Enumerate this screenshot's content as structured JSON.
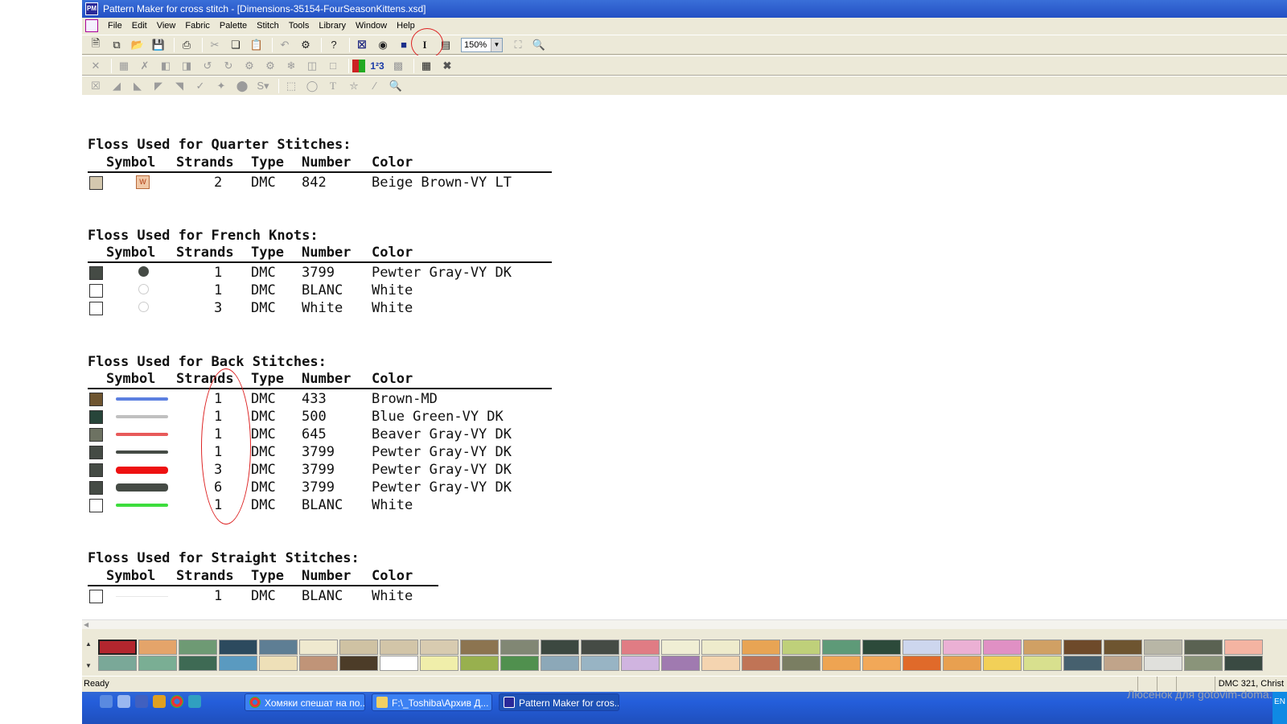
{
  "window": {
    "title": "Pattern Maker for cross stitch - [Dimensions-35154-FourSeasonKittens.xsd]",
    "app_icon_text": "PM"
  },
  "menu": [
    "File",
    "Edit",
    "View",
    "Fabric",
    "Palette",
    "Stitch",
    "Tools",
    "Library",
    "Window",
    "Help"
  ],
  "toolbar": {
    "zoom": "150%"
  },
  "sections": {
    "quarter": {
      "title": "Floss Used for Quarter Stitches:",
      "rows": [
        {
          "symbol": "W",
          "strands": "2",
          "type": "DMC",
          "number": "842",
          "color": "Beige Brown-VY LT",
          "swatch": "#d4c8ae"
        }
      ]
    },
    "french": {
      "title": "Floss Used for French Knots:",
      "rows": [
        {
          "strands": "1",
          "type": "DMC",
          "number": "3799",
          "color": "Pewter Gray-VY DK",
          "swatch": "#454b45",
          "dot": "#454b45"
        },
        {
          "strands": "1",
          "type": "DMC",
          "number": "BLANC",
          "color": "White",
          "swatch": "#ffffff",
          "dot": "#ffffff"
        },
        {
          "strands": "3",
          "type": "DMC",
          "number": "White",
          "color": "White",
          "swatch": "#ffffff",
          "dot": "#ffffff"
        }
      ]
    },
    "back": {
      "title": "Floss Used for Back Stitches:",
      "rows": [
        {
          "strands": "1",
          "type": "DMC",
          "number": "433",
          "color": "Brown-MD",
          "swatch": "#6e5530",
          "line": "#5b7fe0"
        },
        {
          "strands": "1",
          "type": "DMC",
          "number": "500",
          "color": "Blue Green-VY DK",
          "swatch": "#27453a",
          "line": "#c0c0c0"
        },
        {
          "strands": "1",
          "type": "DMC",
          "number": "645",
          "color": "Beaver Gray-VY DK",
          "swatch": "#6d7262",
          "line": "#e85a5a"
        },
        {
          "strands": "1",
          "type": "DMC",
          "number": "3799",
          "color": "Pewter Gray-VY DK",
          "swatch": "#454b45",
          "line": "#454b45"
        },
        {
          "strands": "3",
          "type": "DMC",
          "number": "3799",
          "color": "Pewter Gray-VY DK",
          "swatch": "#454b45",
          "line": "#ee1111"
        },
        {
          "strands": "6",
          "type": "DMC",
          "number": "3799",
          "color": "Pewter Gray-VY DK",
          "swatch": "#454b45",
          "line": "#454b45"
        },
        {
          "strands": "1",
          "type": "DMC",
          "number": "BLANC",
          "color": "White",
          "swatch": "#ffffff",
          "line": "#3ddd3d"
        }
      ]
    },
    "straight": {
      "title": "Floss Used for Straight Stitches:",
      "rows": [
        {
          "strands": "1",
          "type": "DMC",
          "number": "BLANC",
          "color": "White",
          "swatch": "#ffffff",
          "line": "#e8e8e8"
        }
      ]
    }
  },
  "headers": {
    "symbol": "Symbol",
    "strands": "Strands",
    "type": "Type",
    "number": "Number",
    "color": "Color"
  },
  "palette": {
    "row1": [
      "#b3262e",
      "#e4a46a",
      "#6e9a74",
      "#2c4a5e",
      "#5e7e94",
      "#efe9cf",
      "#cfc2a3",
      "#d2c5a8",
      "#d8cbb0",
      "#8c7450",
      "#818774",
      "#3c4840",
      "#454b45",
      "#e07c84",
      "#f0eed4",
      "#eeebcc",
      "#e8a454",
      "#bfd07a",
      "#5e9a78",
      "#2c4a3a",
      "#cdd6ee",
      "#ebb0d4",
      "#e090c4",
      "#d0a064",
      "#6e4a2a",
      "#6e5530",
      "#b8b6a6",
      "#5a6252",
      "#f4b4a2"
    ],
    "row2": [
      "#7aa898",
      "#7aae94",
      "#3e6a54",
      "#5a9ac0",
      "#eee0b8",
      "#c09478",
      "#4c3c28",
      "#ffffff",
      "#f0eeaa",
      "#98b04e",
      "#50904e",
      "#8ca8b8",
      "#98b4c4",
      "#d0b4e0",
      "#a07ab0",
      "#f4d4b0",
      "#c07456",
      "#7a7e62",
      "#eea452",
      "#f2a858",
      "#e06a2a",
      "#e8a050",
      "#f2d058",
      "#d8e08e",
      "#46606e",
      "#c0a48a",
      "#e0e0dc",
      "#8a947a",
      "#3a4a42"
    ]
  },
  "status": {
    "left": "Ready",
    "right": "DMC  321, Christ"
  },
  "taskbar": {
    "items": [
      "Хомяки спешат на по...",
      "F:\\_Toshiba\\Архив Д...",
      "Pattern Maker for cros..."
    ],
    "tray_text": "EN"
  },
  "watermark": "Люсенок для gotovim-doma.ru"
}
